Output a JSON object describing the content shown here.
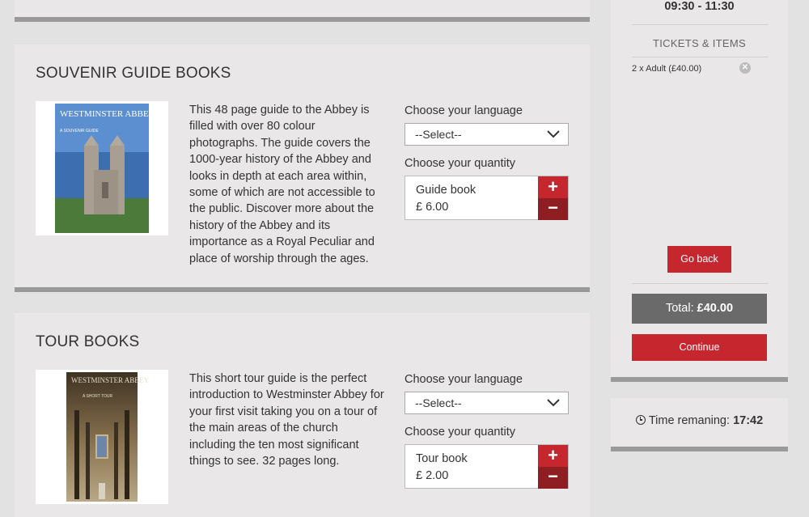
{
  "products": [
    {
      "title": "SOUVENIR GUIDE BOOKS",
      "cover_title": "WESTMINSTER ABBEY",
      "cover_subtitle": "A SOUVENIR GUIDE",
      "description": "This 48 page guide to the Abbey is filled with over 80 colour photographs. The guide covers the 1000-year history of the Abbey and looks in depth at each area within, some of which are not accessible to the public. Discover more about the history of the Abbey and its importance as a Royal Peculiar and place of worship through the ages.",
      "language_label": "Choose your language",
      "language_value": "--Select--",
      "quantity_label": "Choose your quantity",
      "item_name": "Guide book",
      "item_price": "£ 6.00",
      "plus": "+",
      "minus": "−"
    },
    {
      "title": "TOUR BOOKS",
      "cover_title": "WESTMINSTER ABBEY",
      "cover_subtitle": "A SHORT TOUR",
      "description": "This short tour guide is the perfect introduction to Westminster Abbey for your first visit taking you on a tour of the main areas of the church including the ten most significant things to see. 32 pages long.",
      "language_label": "Choose your language",
      "language_value": "--Select--",
      "quantity_label": "Choose your quantity",
      "item_name": "Tour book",
      "item_price": "£ 2.00",
      "plus": "+",
      "minus": "−"
    }
  ],
  "basket": {
    "time_slot": "09:30 - 11:30",
    "tickets_title": "TICKETS & ITEMS",
    "ticket_line": "2  x Adult (£40.00)",
    "remove_glyph": "✕",
    "go_back_label": "Go back",
    "total_label": "Total:",
    "total_value": "£40.00",
    "continue_label": "Continue"
  },
  "timer": {
    "label": "Time remaning:",
    "value": "17:42"
  },
  "colors": {
    "accent_red": "#c6262e",
    "dark_red": "#8e1e22",
    "panel": "#e9e7e8",
    "total_bg": "#6a6a6a"
  }
}
